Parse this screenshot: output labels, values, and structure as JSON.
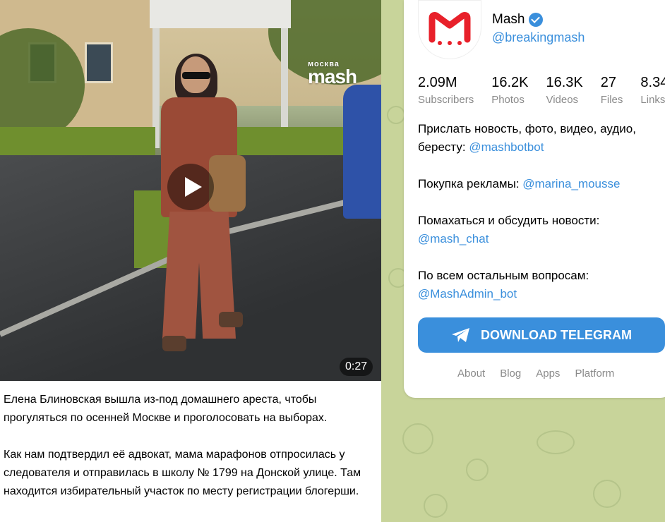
{
  "video": {
    "watermark": "mash",
    "watermark_small": "москва",
    "duration": "0:27"
  },
  "post": {
    "paragraphs": [
      "Елена Блиновская вышла из-под домашнего ареста, чтобы прогуляться по осенней Москве и проголосовать на выборах.",
      "Как нам подтвердил её адвокат, мама марафонов отпросилась у следователя и отправилась в школу № 1799 на Донской улице. Там находится избирательный участок по месту регистрации блогерши."
    ]
  },
  "channel": {
    "name": "Mash",
    "handle": "@breakingmash",
    "stats": [
      {
        "value": "2.09M",
        "label": "Subscribers"
      },
      {
        "value": "16.2K",
        "label": "Photos"
      },
      {
        "value": "16.3K",
        "label": "Videos"
      },
      {
        "value": "27",
        "label": "Files"
      },
      {
        "value": "8.34",
        "label": "Links"
      }
    ],
    "description": [
      {
        "text": "Прислать новость, фото, видео, аудио, бересту: ",
        "link": "@mashbotbot"
      },
      {
        "text": "Покупка рекламы: ",
        "link": "@marina_mousse"
      },
      {
        "text": "Помахаться и обсудить новости: ",
        "link": "@mash_chat"
      },
      {
        "text": "По всем остальным вопросам: ",
        "link": "@MashAdmin_bot"
      }
    ],
    "download_label": "DOWNLOAD TELEGRAM",
    "footer_links": [
      "About",
      "Blog",
      "Apps",
      "Platform"
    ]
  },
  "colors": {
    "accent": "#3a8fdc",
    "logo_red": "#e8202a",
    "wallpaper": "#c8d49a"
  }
}
